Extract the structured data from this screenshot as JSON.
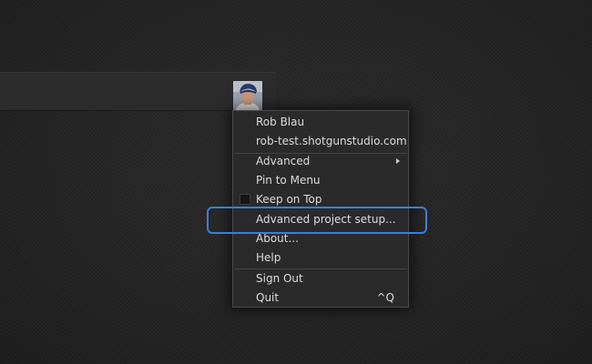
{
  "user": {
    "name": "Rob Blau",
    "site": "rob-test.shotgunstudio.com",
    "avatar_icon": "user-avatar"
  },
  "menu": {
    "advanced_label": "Advanced",
    "pin_to_menu_label": "Pin to Menu",
    "keep_on_top_label": "Keep on Top",
    "keep_on_top_checked": false,
    "advanced_project_setup_label": "Advanced project setup...",
    "about_label": "About...",
    "help_label": "Help",
    "sign_out_label": "Sign Out",
    "quit_label": "Quit",
    "quit_shortcut": "^Q"
  },
  "colors": {
    "highlight": "#3d7fd6",
    "menu_bg": "#2a2a2a",
    "text": "#dcdcdc"
  }
}
